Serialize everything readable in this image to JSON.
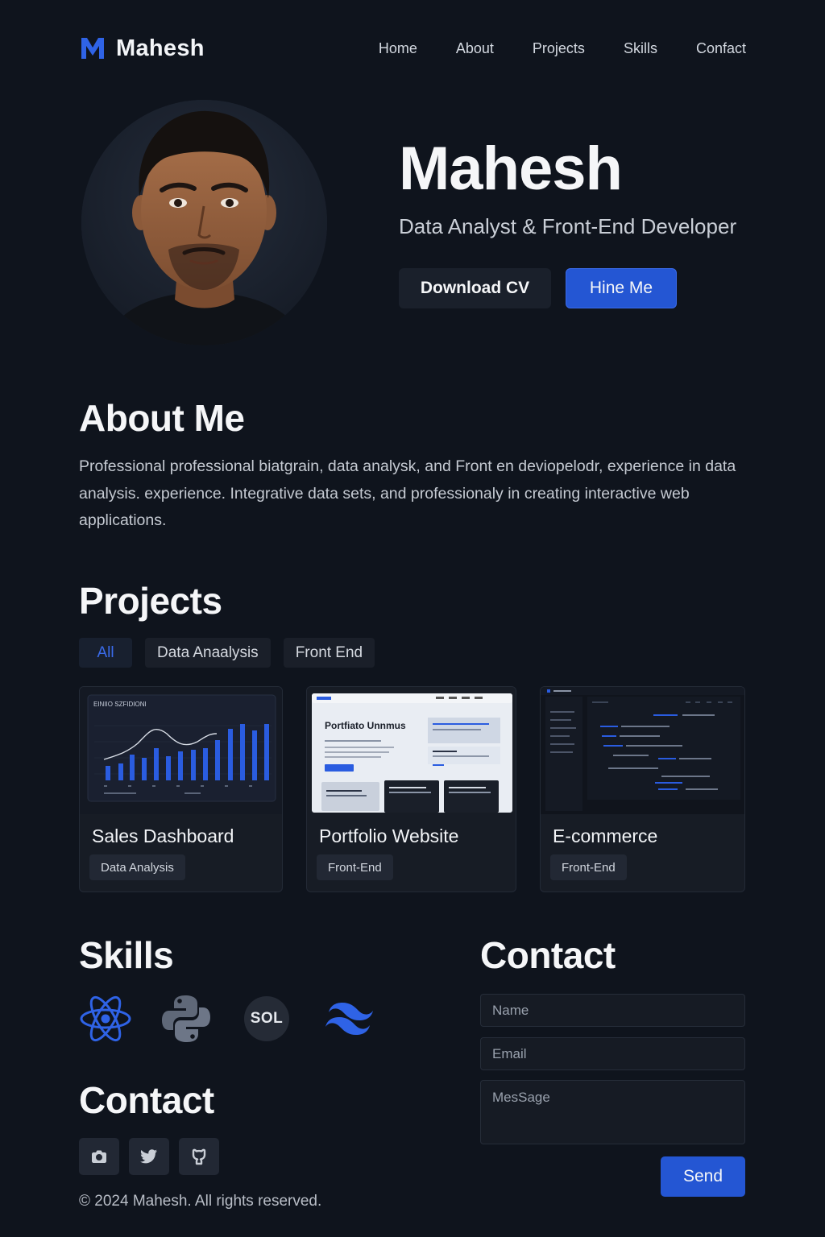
{
  "nav": {
    "brand_letter": "M",
    "brand_name": "Mahesh",
    "links": [
      "Home",
      "About",
      "Projects",
      "Skills",
      "Confact"
    ]
  },
  "hero": {
    "name": "Mahesh",
    "role": "Data Analyst & Front-End Developer",
    "download_label": "Download CV",
    "hire_label": "Hine Me"
  },
  "about": {
    "heading": "About Me",
    "text": "Professional professional biatgrain, data analysk, and Front en deviopelodr, experience in data analysis. experience. Integrative data sets, and professionaly in creating interactive web applications."
  },
  "projects": {
    "heading": "Projects",
    "filters": [
      "All",
      "Data Anaalysis",
      "Front End"
    ],
    "active_filter": "All",
    "cards": [
      {
        "title": "Sales Dashboard",
        "tag": "Data Analysis",
        "thumb_caption": "EINIIO SZFIDIONI"
      },
      {
        "title": "Portfolio Website",
        "tag": "Front-End",
        "thumb_heading": "Portfiato Unnmus"
      },
      {
        "title": "E-commerce",
        "tag": "Front-End"
      }
    ]
  },
  "skills": {
    "heading": "Skills",
    "items": [
      "react-icon",
      "python-icon",
      "SOL",
      "tailwind-icon"
    ],
    "sql_label": "SOL"
  },
  "contact_left": {
    "heading": "Contact",
    "socials": [
      "instagram-icon",
      "twitter-icon",
      "github-icon"
    ]
  },
  "contact_form": {
    "heading": "Contact",
    "name_placeholder": "Name",
    "email_placeholder": "Email",
    "message_placeholder": "MesSage",
    "send_label": "Send"
  },
  "footer": {
    "copyright": "© 2024 Mahesh. All rights reserved."
  },
  "colors": {
    "background": "#0f141d",
    "accent": "#2456d3",
    "card": "#171c25"
  }
}
